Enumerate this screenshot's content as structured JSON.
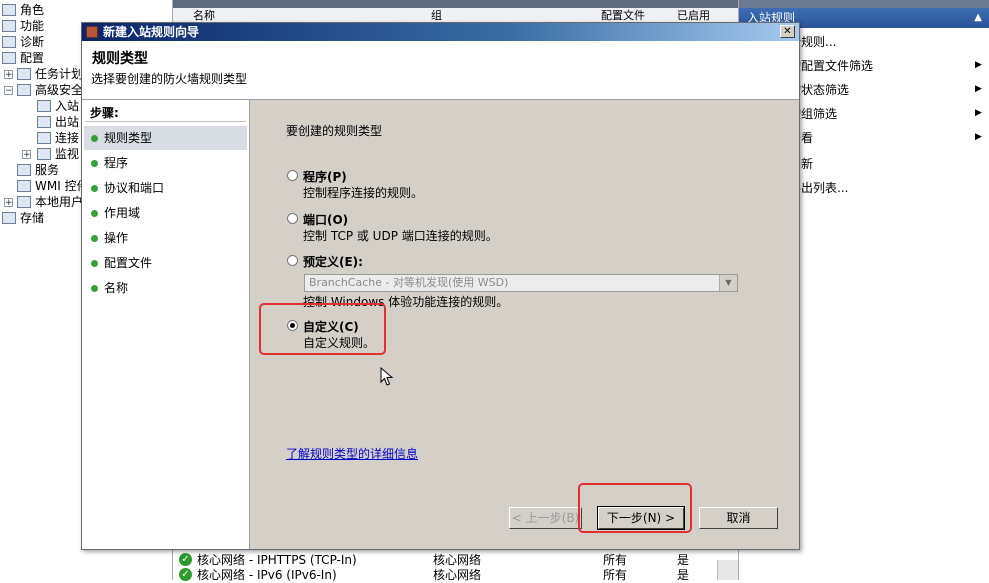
{
  "tree": {
    "items": [
      {
        "label": "角色"
      },
      {
        "label": "功能"
      },
      {
        "label": "诊断"
      },
      {
        "label": "配置"
      },
      {
        "label": "任务计划"
      },
      {
        "label": "高级安全"
      },
      {
        "label": "入站"
      },
      {
        "label": "出站"
      },
      {
        "label": "连接"
      },
      {
        "label": "监视"
      },
      {
        "label": "服务"
      },
      {
        "label": "WMI 控件"
      },
      {
        "label": "本地用户"
      },
      {
        "label": "存储"
      }
    ]
  },
  "table": {
    "headers": {
      "name": "名称",
      "group": "组",
      "profile": "配置文件",
      "enabled": "已启用"
    },
    "rows": [
      {
        "name": "核心网络 - IPHTTPS (TCP-In)",
        "group": "核心网络",
        "profile": "所有",
        "enabled": "是"
      },
      {
        "name": "核心网络 - IPv6 (IPv6-In)",
        "group": "核心网络",
        "profile": "所有",
        "enabled": "是"
      }
    ]
  },
  "actions": {
    "header": "入站规则",
    "items": [
      {
        "label": "新规则..."
      },
      {
        "label": "按配置文件筛选"
      },
      {
        "label": "按状态筛选"
      },
      {
        "label": "按组筛选"
      },
      {
        "label": "查看"
      },
      {
        "label": "刷新"
      },
      {
        "label": "导出列表..."
      }
    ]
  },
  "dialog": {
    "title": "新建入站规则向导",
    "close_glyph": "✕",
    "heading": "规则类型",
    "subheading": "选择要创建的防火墙规则类型",
    "steps_title": "步骤:",
    "steps": [
      {
        "label": "规则类型"
      },
      {
        "label": "程序"
      },
      {
        "label": "协议和端口"
      },
      {
        "label": "作用域"
      },
      {
        "label": "操作"
      },
      {
        "label": "配置文件"
      },
      {
        "label": "名称"
      }
    ],
    "question": "要创建的规则类型",
    "options": {
      "program": {
        "label": "程序(P)",
        "desc": "控制程序连接的规则。"
      },
      "port": {
        "label": "端口(O)",
        "desc": "控制 TCP 或 UDP 端口连接的规则。"
      },
      "predefined": {
        "label": "预定义(E):",
        "combo_value": "BranchCache - 对等机发现(使用 WSD)",
        "desc": "控制 Windows 体验功能连接的规则。"
      },
      "custom": {
        "label": "自定义(C)",
        "desc": "自定义规则。"
      }
    },
    "selected_option": "custom",
    "link": "了解规则类型的详细信息",
    "buttons": {
      "back": "< 上一步(B)",
      "next": "下一步(N) >",
      "cancel": "取消"
    }
  },
  "colors": {
    "highlight": "#e03030",
    "title_bar": "#0a246a",
    "link": "#0000cc"
  }
}
